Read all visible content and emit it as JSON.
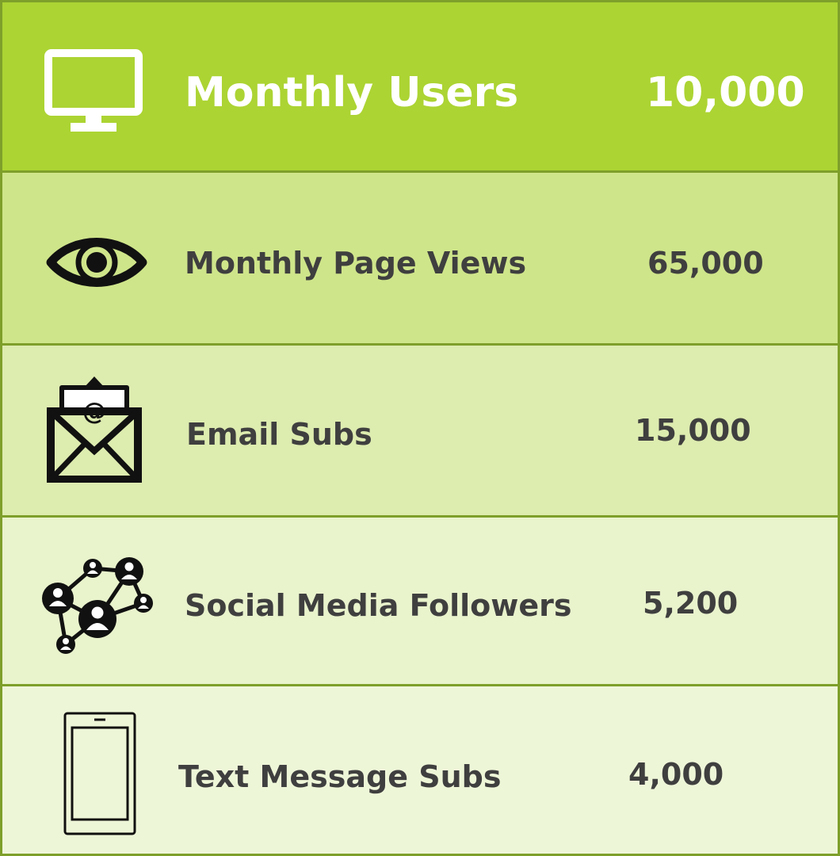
{
  "colors": {
    "border": "#7e9f2a",
    "header_bg": "#acd433",
    "header_text": "#ffffff",
    "body_text": "#3f3f3f"
  },
  "stats": [
    {
      "icon": "monitor-icon",
      "label": "Monthly Users",
      "value": "10,000",
      "bg": "#acd433"
    },
    {
      "icon": "eye-icon",
      "label": "Monthly Page Views",
      "value": "65,000",
      "bg": "#cfe58a"
    },
    {
      "icon": "email-envelope-icon",
      "label": "Email Subs",
      "value": "15,000",
      "bg": "#ddecaf"
    },
    {
      "icon": "social-network-icon",
      "label": "Social Media Followers",
      "value": "5,200",
      "bg": "#e9f3cc"
    },
    {
      "icon": "smartphone-icon",
      "label": "Text Message Subs",
      "value": "4,000",
      "bg": "#eef6d8"
    }
  ]
}
